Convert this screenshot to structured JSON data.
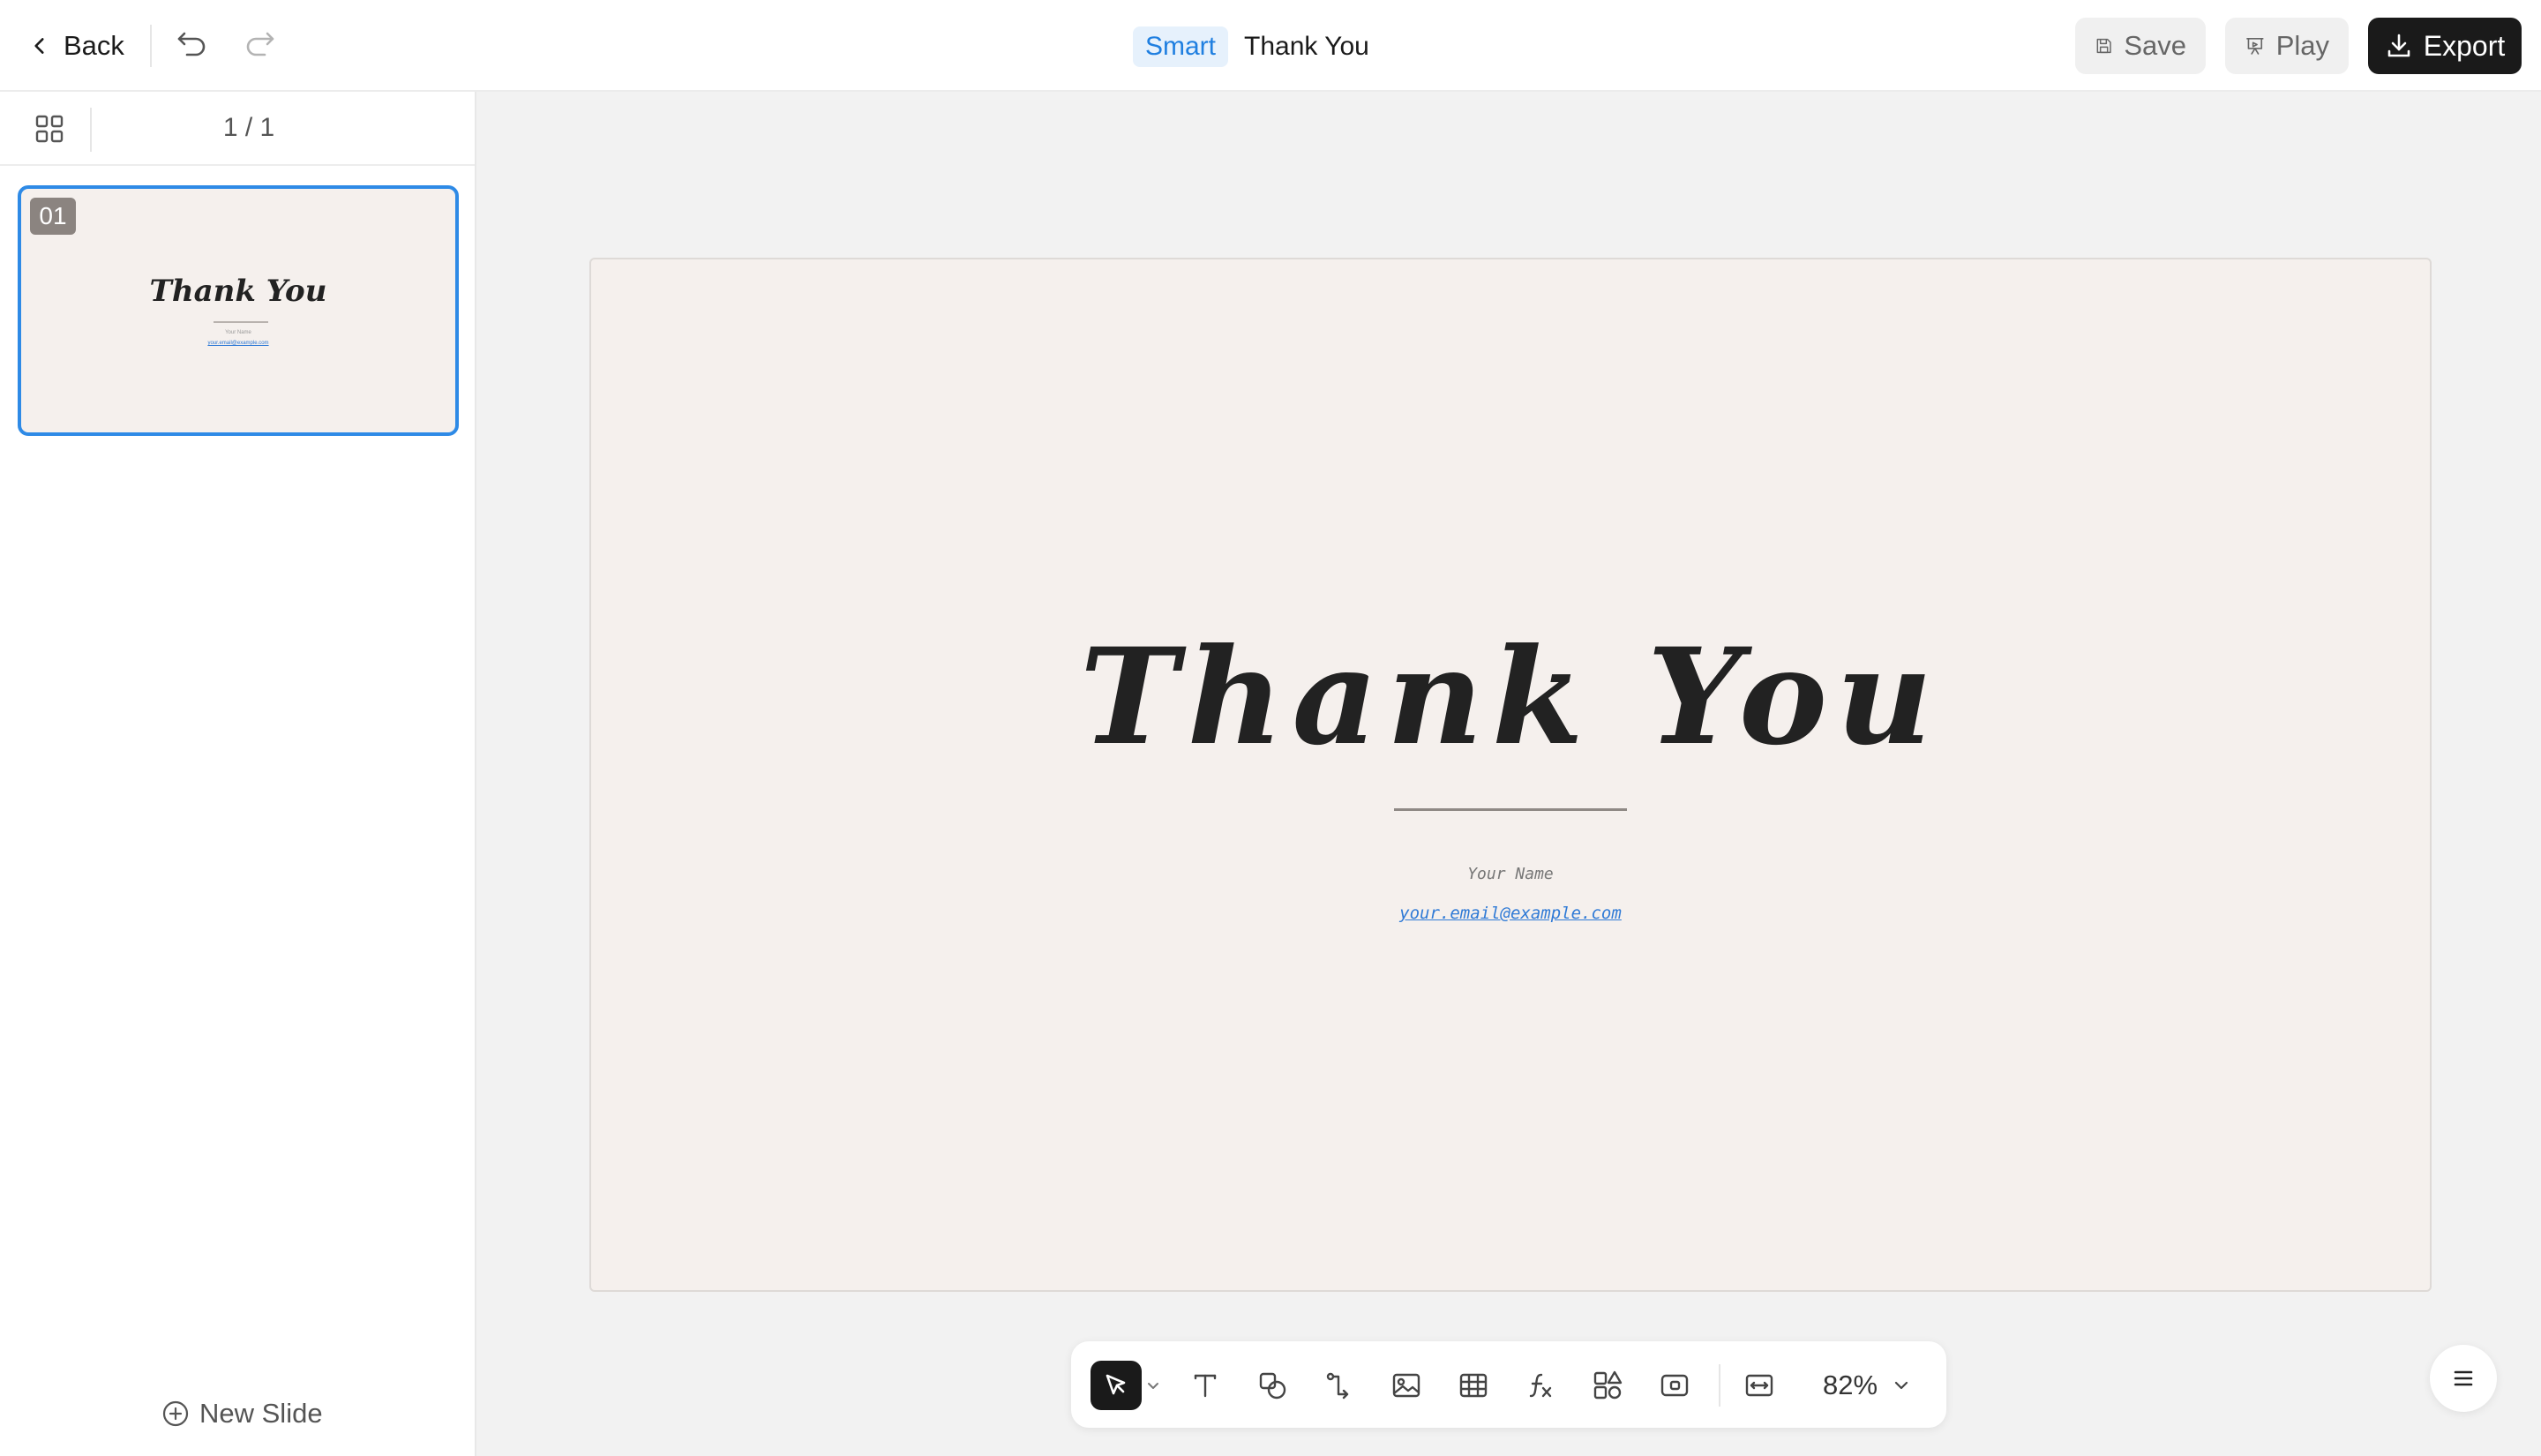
{
  "header": {
    "back_label": "Back",
    "smart_badge": "Smart",
    "title": "Thank You",
    "save_label": "Save",
    "play_label": "Play",
    "export_label": "Export"
  },
  "sidebar": {
    "page_count": "1 / 1",
    "slides": [
      {
        "number": "01",
        "title": "Thank You",
        "name": "Your Name",
        "email": "your.email@example.com"
      }
    ],
    "new_slide_label": "New Slide"
  },
  "slide": {
    "title": "Thank You",
    "name": "Your Name",
    "email": "your.email@example.com"
  },
  "toolbar": {
    "tools": [
      "select-icon",
      "text-icon",
      "shapes-icon",
      "connector-icon",
      "image-icon",
      "table-icon",
      "formula-icon",
      "components-icon",
      "media-icon",
      "fit-width-icon"
    ],
    "zoom": "82%"
  },
  "colors": {
    "accent": "#2e8ae6",
    "smart_badge_bg": "#e6f1fc",
    "export_bg": "#1a1a1a",
    "slide_bg": "#f5f0ed",
    "link": "#2f7ad6"
  }
}
